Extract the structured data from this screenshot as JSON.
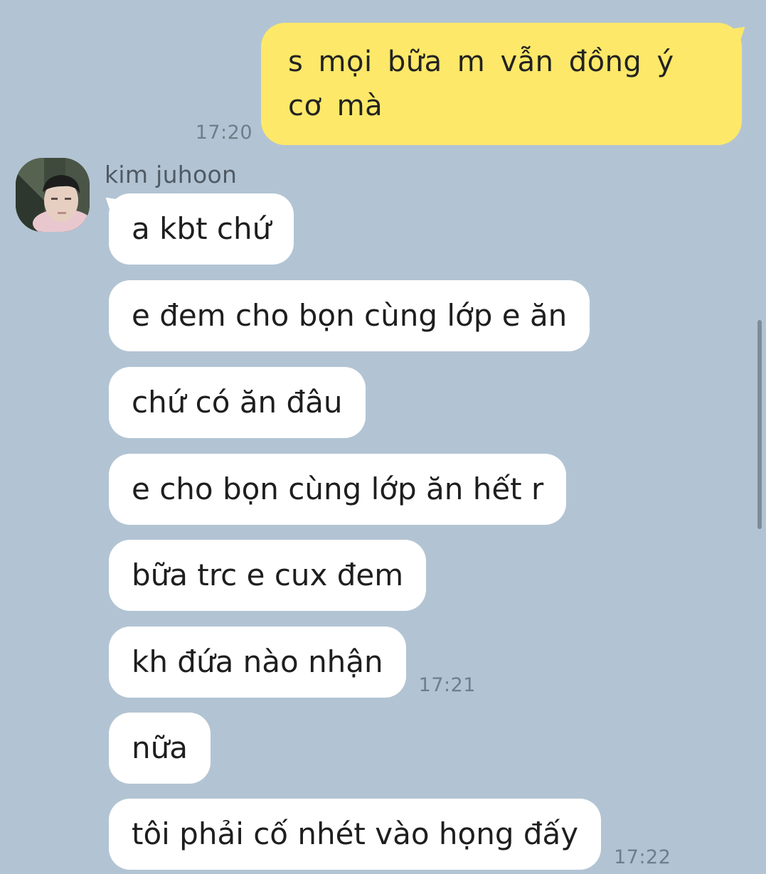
{
  "outgoing": {
    "text": "s mọi bữa m vẫn đồng ý cơ mà",
    "time": "17:20"
  },
  "sender": {
    "name": "kim juhoon",
    "avatar": "profile-photo"
  },
  "incoming": [
    {
      "text": "a kbt chứ",
      "time": ""
    },
    {
      "text": "e đem cho bọn cùng lớp e ăn",
      "time": ""
    },
    {
      "text": "chứ có ăn đâu",
      "time": ""
    },
    {
      "text": "e cho bọn cùng lớp ăn hết r",
      "time": ""
    },
    {
      "text": "bữa trc e cux đem",
      "time": ""
    },
    {
      "text": "kh đứa nào nhận",
      "time": "17:21"
    },
    {
      "text": "nữa",
      "time": ""
    },
    {
      "text": "tôi phải cố nhét vào họng đấy",
      "time": "17:22"
    }
  ],
  "colors": {
    "background": "#b2c4d3",
    "outgoing_bubble": "#fde869",
    "incoming_bubble": "#ffffff"
  }
}
